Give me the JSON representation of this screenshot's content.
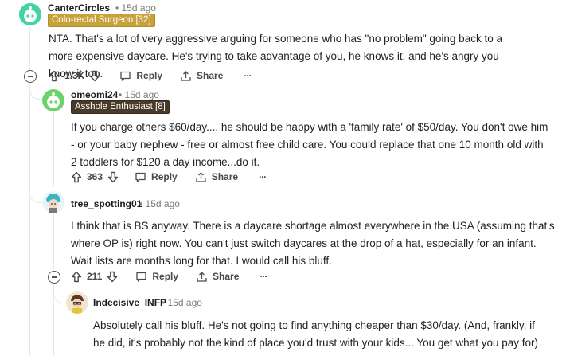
{
  "comments": [
    {
      "username": "CanterCircles",
      "time": "15d ago",
      "flair": "Colo-rectal Surgeon [32]",
      "body": "NTA. That's a lot of very aggressive arguing for someone who has \"no problem\" going back to a more expensive daycare. He's trying to take advantage of you, he knows it, and he's angry you know it too.",
      "votes": "1.3K",
      "reply_label": "Reply",
      "share_label": "Share",
      "more_label": "···"
    },
    {
      "username": "omeomi24",
      "time": "15d ago",
      "flair": "Asshole Enthusiast [8]",
      "body": "If you charge others $60/day.... he should be happy with a 'family rate' of $50/day. You don't owe him - or your baby nephew - free or almost free child care. You could replace that one 10 month old with 2 toddlers for $120 a day income...do it.",
      "votes": "363",
      "reply_label": "Reply",
      "share_label": "Share",
      "more_label": "···"
    },
    {
      "username": "tree_spotting01",
      "time": "15d ago",
      "body": "I think that is BS anyway. There is a daycare shortage almost everywhere in the USA (assuming that's where OP is) right now. You can't just switch daycares at the drop of a hat, especially for an infant. Wait lists are months long for that. I would call his bluff.",
      "votes": "211",
      "reply_label": "Reply",
      "share_label": "Share",
      "more_label": "···"
    },
    {
      "username": "Indecisive_INFP",
      "time": "15d ago",
      "body": "Absolutely call his bluff. He's not going to find anything cheaper than $30/day. (And, frankly, if he did, it's probably not the kind of place you'd trust with your kids... You get what you pay for)"
    }
  ],
  "separator": "•",
  "colors": {
    "flair1_bg": "#c7a23a",
    "flair2_bg": "#4a3a2a",
    "thread_line": "#e5e7eb"
  }
}
